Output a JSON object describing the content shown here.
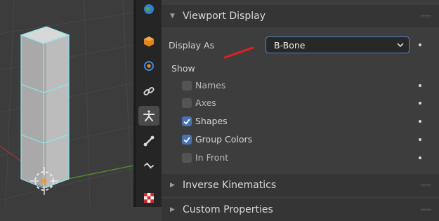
{
  "panel": {
    "title": "Viewport Display",
    "display_as_label": "Display As",
    "display_as_value": "B-Bone",
    "show_label": "Show",
    "options": [
      {
        "label": "Names",
        "checked": false
      },
      {
        "label": "Axes",
        "checked": false
      },
      {
        "label": "Shapes",
        "checked": true
      },
      {
        "label": "Group Colors",
        "checked": true
      },
      {
        "label": "In Front",
        "checked": false
      }
    ]
  },
  "collapsed_panels": [
    "Inverse Kinematics",
    "Custom Properties"
  ],
  "colors": {
    "accent": "#4772b3",
    "annotation": "#e02020",
    "selection": "#63d6e6"
  },
  "tab_icons": [
    "world-icon",
    "object-icon",
    "physics-icon",
    "constraint-icon",
    "armature-data-icon",
    "bone-icon",
    "bone-constraint-icon",
    "texture-icon"
  ]
}
